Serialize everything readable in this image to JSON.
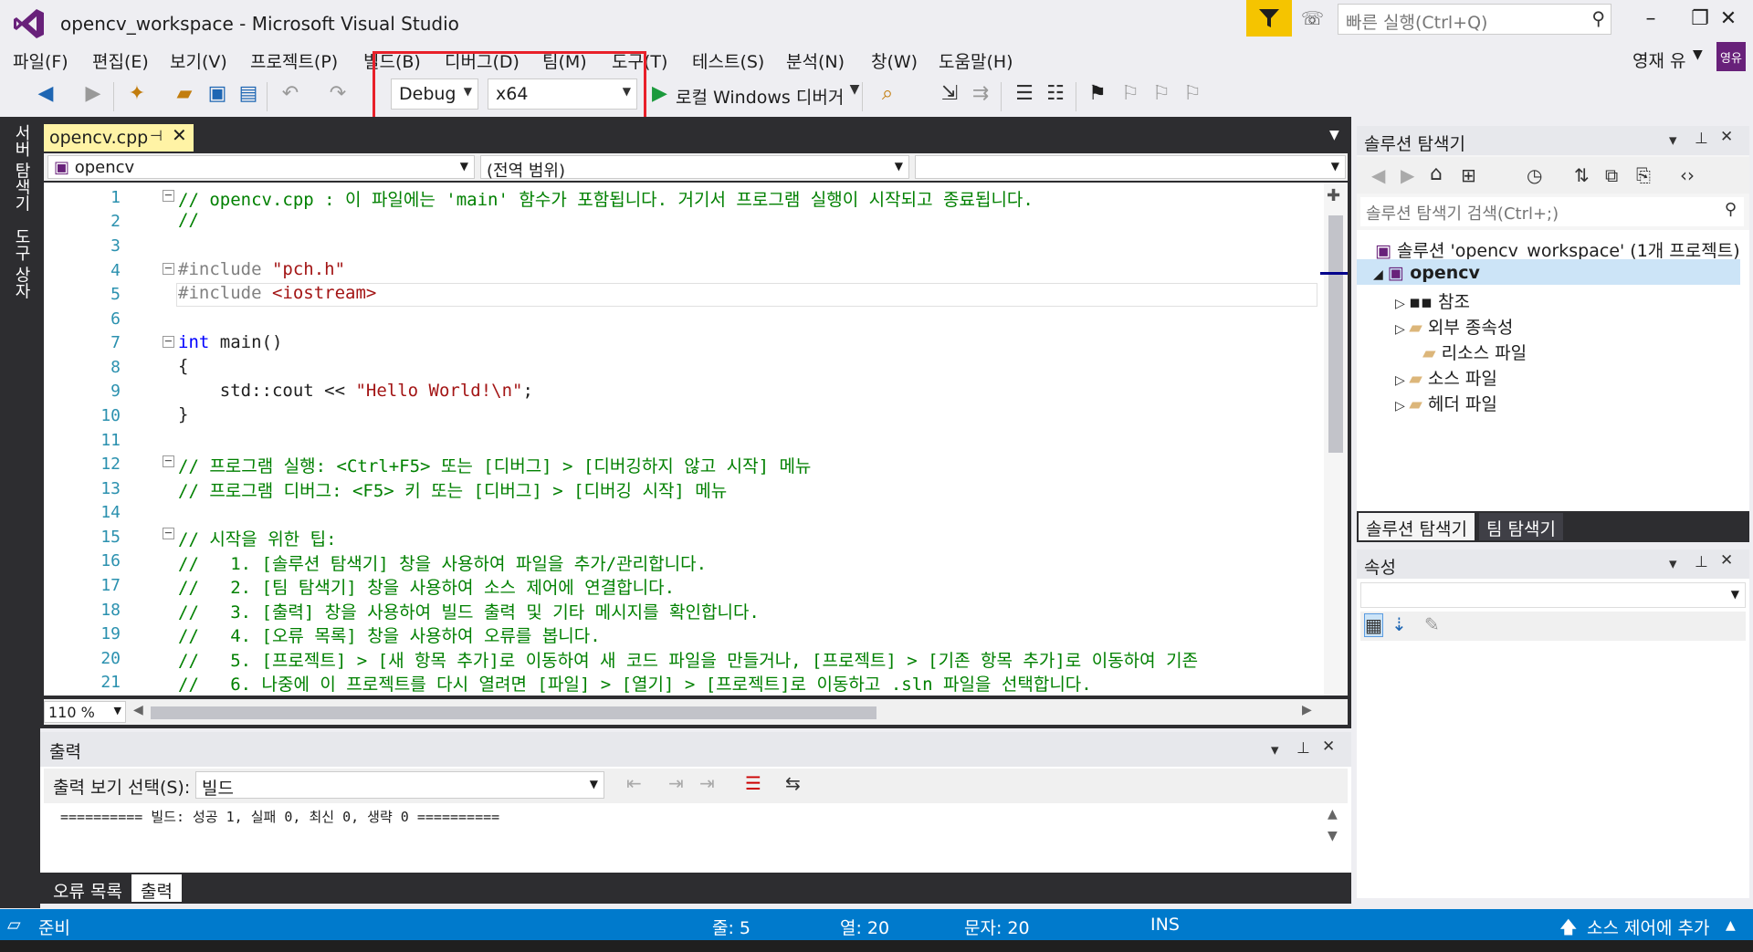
{
  "window": {
    "title": "opencv_workspace - Microsoft Visual Studio",
    "quick_launch_placeholder": "빠른 실행(Ctrl+Q)",
    "minimize": "–",
    "maximize": "❐",
    "close": "✕"
  },
  "menu": [
    "파일(F)",
    "편집(E)",
    "보기(V)",
    "프로젝트(P)",
    "빌드(B)",
    "디버그(D)",
    "팀(M)",
    "도구(T)",
    "테스트(S)",
    "분석(N)",
    "창(W)",
    "도움말(H)"
  ],
  "user": {
    "name": "영재 유",
    "avatar_text": "영유"
  },
  "toolbar": {
    "config": "Debug",
    "platform": "x64",
    "debugger": "로컬 Windows 디버거"
  },
  "left_rail": {
    "tabs": [
      "서버 탐색기",
      "도구 상자"
    ]
  },
  "editor": {
    "tab_name": "opencv.cpp",
    "nav_project": "opencv",
    "nav_scope": "(전역 범위)",
    "zoom": "110 %",
    "line_numbers": [
      "1",
      "2",
      "3",
      "4",
      "5",
      "6",
      "7",
      "8",
      "9",
      "10",
      "11",
      "12",
      "13",
      "14",
      "15",
      "16",
      "17",
      "18",
      "19",
      "20",
      "21"
    ],
    "lines": {
      "l1": "// opencv.cpp : 이 파일에는 'main' 함수가 포함됩니다. 거기서 프로그램 실행이 시작되고 종료됩니다.",
      "l2": "//",
      "l4_pp": "#include ",
      "l4_str": "\"pch.h\"",
      "l5_pp": "#include ",
      "l5_str": "<iostream>",
      "l7_kw": "int",
      "l7_rest": " main()",
      "l8": "{",
      "l9_a": "    std::cout << ",
      "l9_str": "\"Hello World!\\n\"",
      "l9_b": ";",
      "l10": "}",
      "l12": "// 프로그램 실행: <Ctrl+F5> 또는 [디버그] > [디버깅하지 않고 시작] 메뉴",
      "l13": "// 프로그램 디버그: <F5> 키 또는 [디버그] > [디버깅 시작] 메뉴",
      "l15": "// 시작을 위한 팁:",
      "l16": "//   1. [솔루션 탐색기] 창을 사용하여 파일을 추가/관리합니다.",
      "l17": "//   2. [팀 탐색기] 창을 사용하여 소스 제어에 연결합니다.",
      "l18": "//   3. [출력] 창을 사용하여 빌드 출력 및 기타 메시지를 확인합니다.",
      "l19": "//   4. [오류 목록] 창을 사용하여 오류를 봅니다.",
      "l20": "//   5. [프로젝트] > [새 항목 추가]로 이동하여 새 코드 파일을 만들거나, [프로젝트] > [기존 항목 추가]로 이동하여 기존",
      "l21": "//   6. 나중에 이 프로젝트를 다시 열려면 [파일] > [열기] > [프로젝트]로 이동하고 .sln 파일을 선택합니다."
    }
  },
  "output": {
    "title": "출력",
    "source_label": "출력 보기 선택(S):",
    "source_value": "빌드",
    "text": "========== 빌드: 성공 1, 실패 0, 최신 0, 생략 0 ==========",
    "tabs": [
      "오류 목록",
      "출력"
    ]
  },
  "solution_explorer": {
    "title": "솔루션 탐색기",
    "search_placeholder": "솔루션 탐색기 검색(Ctrl+;)",
    "solution": "솔루션 'opencv_workspace' (1개 프로젝트)",
    "project": "opencv",
    "items": [
      "참조",
      "외부 종속성",
      "리소스 파일",
      "소스 파일",
      "헤더 파일"
    ],
    "tabs": [
      "솔루션 탐색기",
      "팀 탐색기"
    ]
  },
  "properties": {
    "title": "속성"
  },
  "status": {
    "ready": "준비",
    "line": "줄: 5",
    "col": "열: 20",
    "ch": "문자: 20",
    "ins": "INS",
    "source_control": "소스 제어에 추가"
  }
}
